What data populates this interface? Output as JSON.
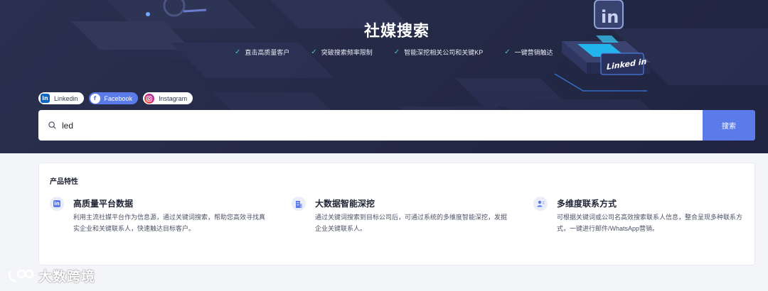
{
  "hero": {
    "title": "社媒搜索",
    "features": [
      "直击高质量客户",
      "突破搜索频率限制",
      "智能深挖相关公司和关键KP",
      "一键营销触达"
    ],
    "badge_text": "Linked in",
    "badge_logo": "in"
  },
  "platform_tabs": [
    {
      "label": "Linkedin",
      "icon": "linkedin-icon",
      "active": false
    },
    {
      "label": "Facebook",
      "icon": "facebook-icon",
      "active": true
    },
    {
      "label": "Instagram",
      "icon": "instagram-icon",
      "active": false
    }
  ],
  "search": {
    "value": "led",
    "button_label": "搜索"
  },
  "product_features": {
    "heading": "产品特性",
    "items": [
      {
        "icon": "linkedin-icon",
        "title": "高质量平台数据",
        "desc": "利用主流社媒平台作为信息源，通过关键词搜索，帮助您高效寻找真实企业和关键联系人，快速触达目标客户。"
      },
      {
        "icon": "building-icon",
        "title": "大数据智能深挖",
        "desc": "通过关键词搜索到目标公司后，可通过系统的多维度智能深挖，发掘企业关键联系人。"
      },
      {
        "icon": "contacts-icon",
        "title": "多维度联系方式",
        "desc": "可根据关键词或公司名高效搜索联系人信息，整合呈现多种联系方式，一键进行邮件/WhatsApp营销。"
      }
    ]
  },
  "watermark": {
    "text": "大数跨境"
  },
  "colors": {
    "accent": "#5b7bea",
    "hero_bg": "#262b48",
    "check": "#4cc7b3"
  }
}
